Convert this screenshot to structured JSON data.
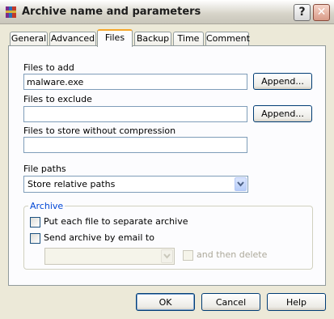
{
  "window": {
    "title": "Archive name and parameters",
    "help_glyph": "?",
    "close_glyph": "✕"
  },
  "tabs": [
    {
      "label": "General"
    },
    {
      "label": "Advanced"
    },
    {
      "label": "Files",
      "active": true
    },
    {
      "label": "Backup"
    },
    {
      "label": "Time"
    },
    {
      "label": "Comment"
    }
  ],
  "files_to_add": {
    "label": "Files to add",
    "value": "malware.exe",
    "append_label": "Append..."
  },
  "files_to_exclude": {
    "label": "Files to exclude",
    "value": "",
    "append_label": "Append..."
  },
  "files_no_compression": {
    "label": "Files to store without compression",
    "value": ""
  },
  "file_paths": {
    "label": "File paths",
    "selected": "Store relative paths"
  },
  "archive_group": {
    "title": "Archive",
    "separate_archive": {
      "label": "Put each file to separate archive",
      "checked": false
    },
    "send_by_email": {
      "label": "Send archive by email to",
      "checked": false
    },
    "email_select_value": "",
    "then_delete": {
      "label": "and then delete",
      "checked": false,
      "disabled": true
    }
  },
  "buttons": {
    "ok": "OK",
    "cancel": "Cancel",
    "help": "Help"
  },
  "icons": {
    "app": "winrar-books-icon",
    "dropdown": "chevron-down-icon"
  }
}
